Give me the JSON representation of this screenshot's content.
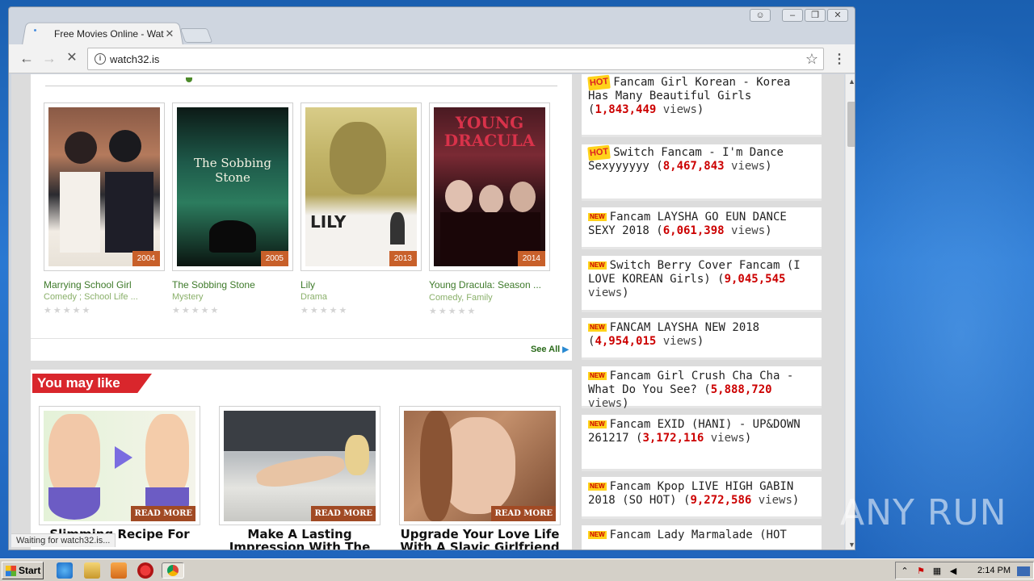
{
  "browser": {
    "tab_title": "Free Movies Online - Watch",
    "tab_close": "✕",
    "url": "watch32.is",
    "status": "Waiting for watch32.is..."
  },
  "movies": [
    {
      "title": "Marrying School Girl",
      "genre": "Comedy ; School Life ...",
      "year": "2004",
      "poster_text": ""
    },
    {
      "title": "The Sobbing Stone",
      "genre": "Mystery",
      "year": "2005",
      "poster_text": "The Sobbing Stone"
    },
    {
      "title": "Lily",
      "genre": "Drama",
      "year": "2013",
      "poster_text": "LILY"
    },
    {
      "title": "Young Dracula: Season ...",
      "genre": "Comedy, Family",
      "year": "2014",
      "poster_text": "YOUNG DRACULA"
    }
  ],
  "stars": "★★★★★",
  "see_all": "See All",
  "you_may_like": {
    "title": "You may like",
    "read_more": "READ MORE",
    "items": [
      {
        "title": "Slimming Recipe For"
      },
      {
        "title": "Make A Lasting Impression With The"
      },
      {
        "title": "Upgrade Your Love Life With A Slavic Girlfriend"
      }
    ]
  },
  "sidebar": {
    "hot_label": "HOT",
    "new_label": "NEW",
    "views_word": "views",
    "items": [
      {
        "badge": "hot",
        "title": "Fancam Girl Korean - Korea Has Many Beautiful Girls",
        "views": "1,843,449"
      },
      {
        "badge": "hot",
        "title": "Switch Fancam - I'm Dance Sexyyyyyy",
        "views": "8,467,843"
      },
      {
        "badge": "new",
        "title": "Fancam LAYSHA GO EUN DANCE SEXY 2018",
        "views": "6,061,398"
      },
      {
        "badge": "new",
        "title": "Switch Berry Cover Fancam (I LOVE KOREAN Girls)",
        "views": "9,045,545"
      },
      {
        "badge": "new",
        "title": "FANCAM LAYSHA NEW 2018",
        "views": "4,954,015"
      },
      {
        "badge": "new",
        "title": "Fancam Girl Crush Cha Cha - What Do You See?",
        "views": "5,888,720"
      },
      {
        "badge": "new",
        "title": "Fancam EXID (HANI) - UP&DOWN 261217",
        "views": "3,172,116"
      },
      {
        "badge": "new",
        "title": "Fancam Kpop LIVE HIGH GABIN 2018 (SO HOT)",
        "views": "9,272,586"
      },
      {
        "badge": "new",
        "title": "Fancam Lady Marmalade (HOT",
        "views": ""
      }
    ]
  },
  "taskbar": {
    "start": "Start",
    "clock": "2:14 PM"
  },
  "watermark": "ANY RUN"
}
